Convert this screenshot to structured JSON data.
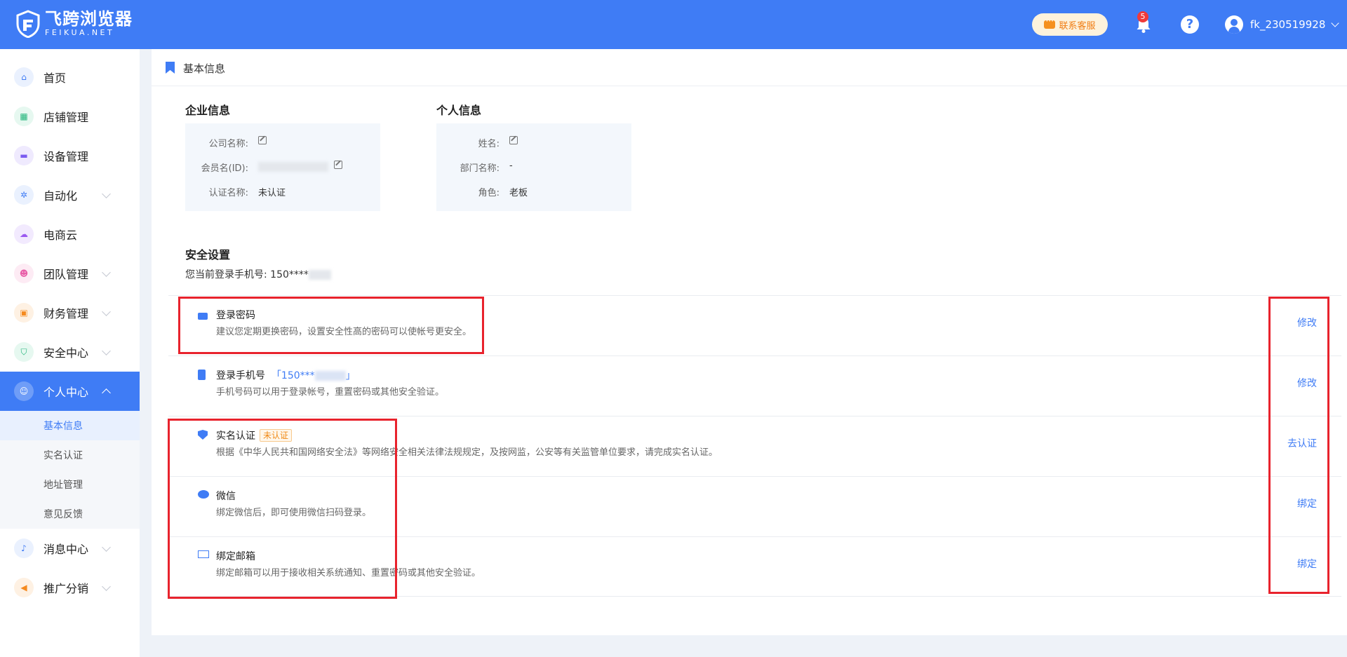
{
  "header": {
    "brand_cn": "飞跨浏览器",
    "brand_en": "FEIKUA.NET",
    "support_label": "联系客服",
    "notification_count": "5",
    "help_symbol": "?",
    "username": "fk_230519928",
    "accent_color": "#3f7cf5"
  },
  "sidebar": {
    "items": [
      {
        "label": "首页",
        "icon": "home-icon",
        "color": "#3f7cf5",
        "bg": "#eaf1fe"
      },
      {
        "label": "店铺管理",
        "icon": "store-icon",
        "color": "#21b57a",
        "bg": "#e6f8f0"
      },
      {
        "label": "设备管理",
        "icon": "device-icon",
        "color": "#7b5cf0",
        "bg": "#efeafe"
      },
      {
        "label": "自动化",
        "icon": "automation-icon",
        "color": "#3f7cf5",
        "bg": "#eaf1fe"
      },
      {
        "label": "电商云",
        "icon": "cloud-icon",
        "color": "#9b59f0",
        "bg": "#f2eafe"
      },
      {
        "label": "团队管理",
        "icon": "team-icon",
        "color": "#e85fa8",
        "bg": "#fdebf4"
      },
      {
        "label": "财务管理",
        "icon": "wallet-icon",
        "color": "#f58a1f",
        "bg": "#fef1e3"
      },
      {
        "label": "安全中心",
        "icon": "shield-icon",
        "color": "#21b57a",
        "bg": "#e6f8f0"
      },
      {
        "label": "个人中心",
        "icon": "user-icon",
        "color": "#ffffff",
        "bg": "#6c9af7"
      },
      {
        "label": "消息中心",
        "icon": "bell-icon",
        "color": "#3f7cf5",
        "bg": "#eaf1fe"
      },
      {
        "label": "推广分销",
        "icon": "megaphone-icon",
        "color": "#f58a1f",
        "bg": "#fef1e3"
      }
    ],
    "sub_items": [
      "基本信息",
      "实名认证",
      "地址管理",
      "意见反馈"
    ]
  },
  "breadcrumb": {
    "title": "基本信息"
  },
  "company": {
    "title": "企业信息",
    "rows": [
      {
        "label": "公司名称:",
        "value": ""
      },
      {
        "label": "会员名(ID):",
        "value": ""
      },
      {
        "label": "认证名称:",
        "value": "未认证"
      }
    ]
  },
  "personal": {
    "title": "个人信息",
    "rows": [
      {
        "label": "姓名:",
        "value": ""
      },
      {
        "label": "部门名称:",
        "value": "-"
      },
      {
        "label": "角色:",
        "value": "老板"
      }
    ]
  },
  "security": {
    "title": "安全设置",
    "phone_line": "您当前登录手机号: 150****",
    "rows": [
      {
        "title": "登录密码",
        "desc": "建议您定期更换密码，设置安全性高的密码可以使帐号更安全。",
        "action": "修改",
        "icon": "lock-icon"
      },
      {
        "title": "登录手机号",
        "phone": "「150***",
        "phone_end": "」",
        "desc": "手机号码可以用于登录帐号，重置密码或其他安全验证。",
        "action": "修改",
        "icon": "phone-icon"
      },
      {
        "title": "实名认证",
        "tag": "未认证",
        "desc": "根据《中华人民共和国网络安全法》等网络安全相关法律法规规定，及按网监，公安等有关监管单位要求，请完成实名认证。",
        "action": "去认证",
        "icon": "verified-shield-icon"
      },
      {
        "title": "微信",
        "desc": "绑定微信后，即可使用微信扫码登录。",
        "action": "绑定",
        "icon": "wechat-icon"
      },
      {
        "title": "绑定邮箱",
        "desc": "绑定邮箱可以用于接收相关系统通知、重置密码或其他安全验证。",
        "action": "绑定",
        "icon": "mail-icon"
      }
    ]
  }
}
